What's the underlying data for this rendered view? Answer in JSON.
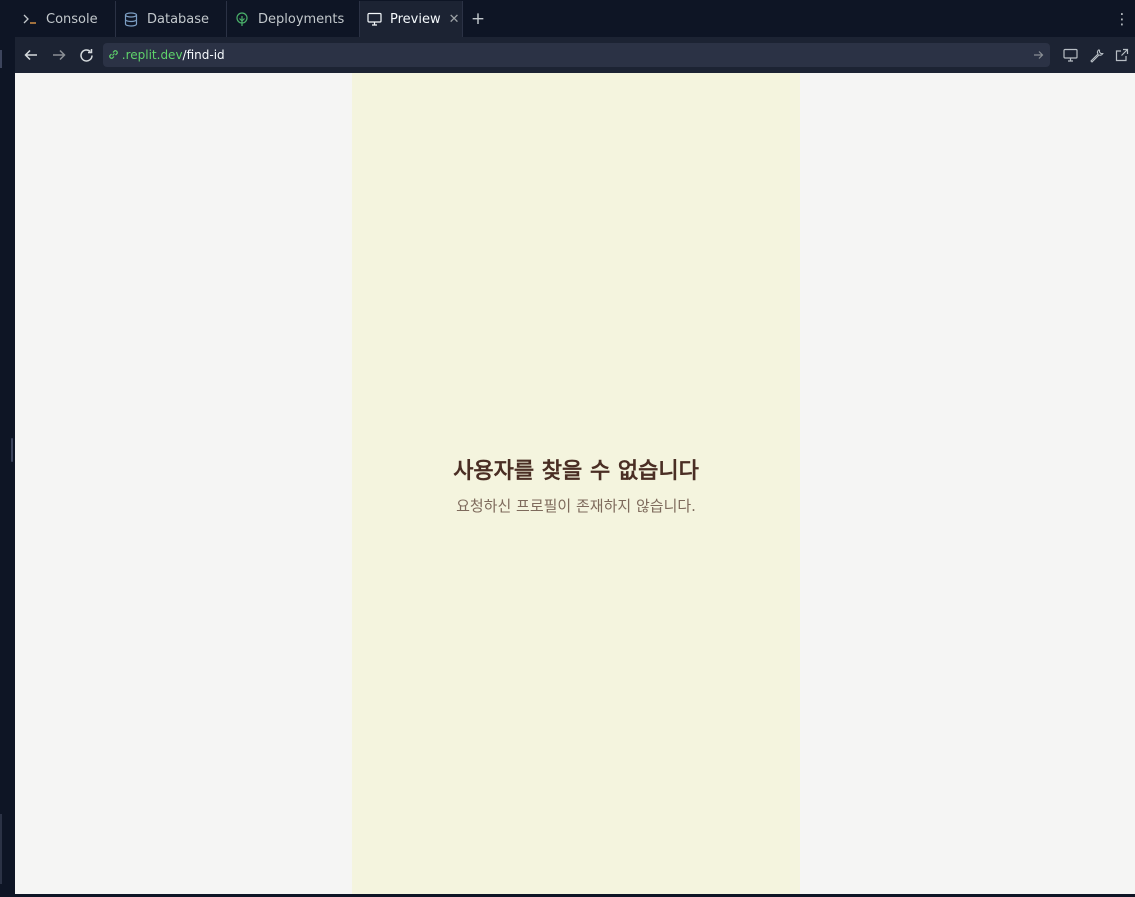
{
  "tabs": [
    {
      "label": "Console",
      "icon": "console-icon"
    },
    {
      "label": "Database",
      "icon": "database-icon"
    },
    {
      "label": "Deployments",
      "icon": "deployments-icon"
    },
    {
      "label": "Preview",
      "icon": "monitor-icon",
      "active": true
    }
  ],
  "urlbar": {
    "host": ".replit.dev",
    "path": "/find-id"
  },
  "preview": {
    "title": "사용자를 찾을 수 없습니다",
    "subtitle": "요청하신 프로필이 존재하지 않습니다."
  },
  "colors": {
    "chrome_bg": "#0e1525",
    "toolbar_bg": "#1c2333",
    "url_host": "#5fd36b",
    "page_bg": "#f5f5f4",
    "app_column_bg": "#f4f4de",
    "title_text": "#4a2e24",
    "subtitle_text": "#7e6a5c"
  }
}
